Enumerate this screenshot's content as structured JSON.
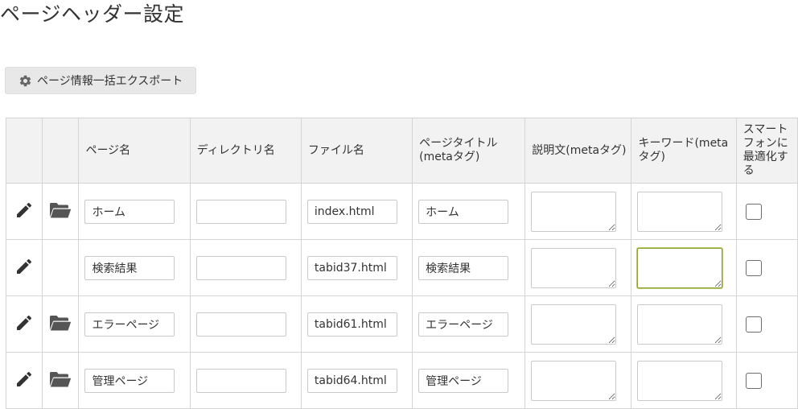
{
  "page": {
    "title": "ページヘッダー設定",
    "export_button_label": "ページ情報一括エクスポート"
  },
  "table": {
    "headers": {
      "page_name": "ページ名",
      "directory": "ディレクトリ名",
      "file_name": "ファイル名",
      "page_title": "ページタイトル(metaタグ)",
      "description": "説明文(metaタグ)",
      "keywords": "キーワード(metaタグ)",
      "mobile": "スマートフォンに最適化する"
    },
    "rows": [
      {
        "page_name": "ホーム",
        "directory": "",
        "file_name": "index.html",
        "page_title": "ホーム",
        "has_folder": true,
        "keywords_focused": false
      },
      {
        "page_name": "検索結果",
        "directory": "",
        "file_name": "tabid37.html",
        "page_title": "検索結果",
        "has_folder": false,
        "keywords_focused": true
      },
      {
        "page_name": "エラーページ",
        "directory": "",
        "file_name": "tabid61.html",
        "page_title": "エラーページ",
        "has_folder": true,
        "keywords_focused": false
      },
      {
        "page_name": "管理ページ",
        "directory": "",
        "file_name": "tabid64.html",
        "page_title": "管理ページ",
        "has_folder": true,
        "keywords_focused": false
      }
    ]
  },
  "icons": {
    "export": "gear-icon",
    "edit": "pencil-icon",
    "folder": "folder-open-icon"
  },
  "colors": {
    "header_background": "#f2f2f2",
    "border": "#d4d4d4",
    "focus_border": "#8ba32a",
    "icon": "#333333"
  }
}
